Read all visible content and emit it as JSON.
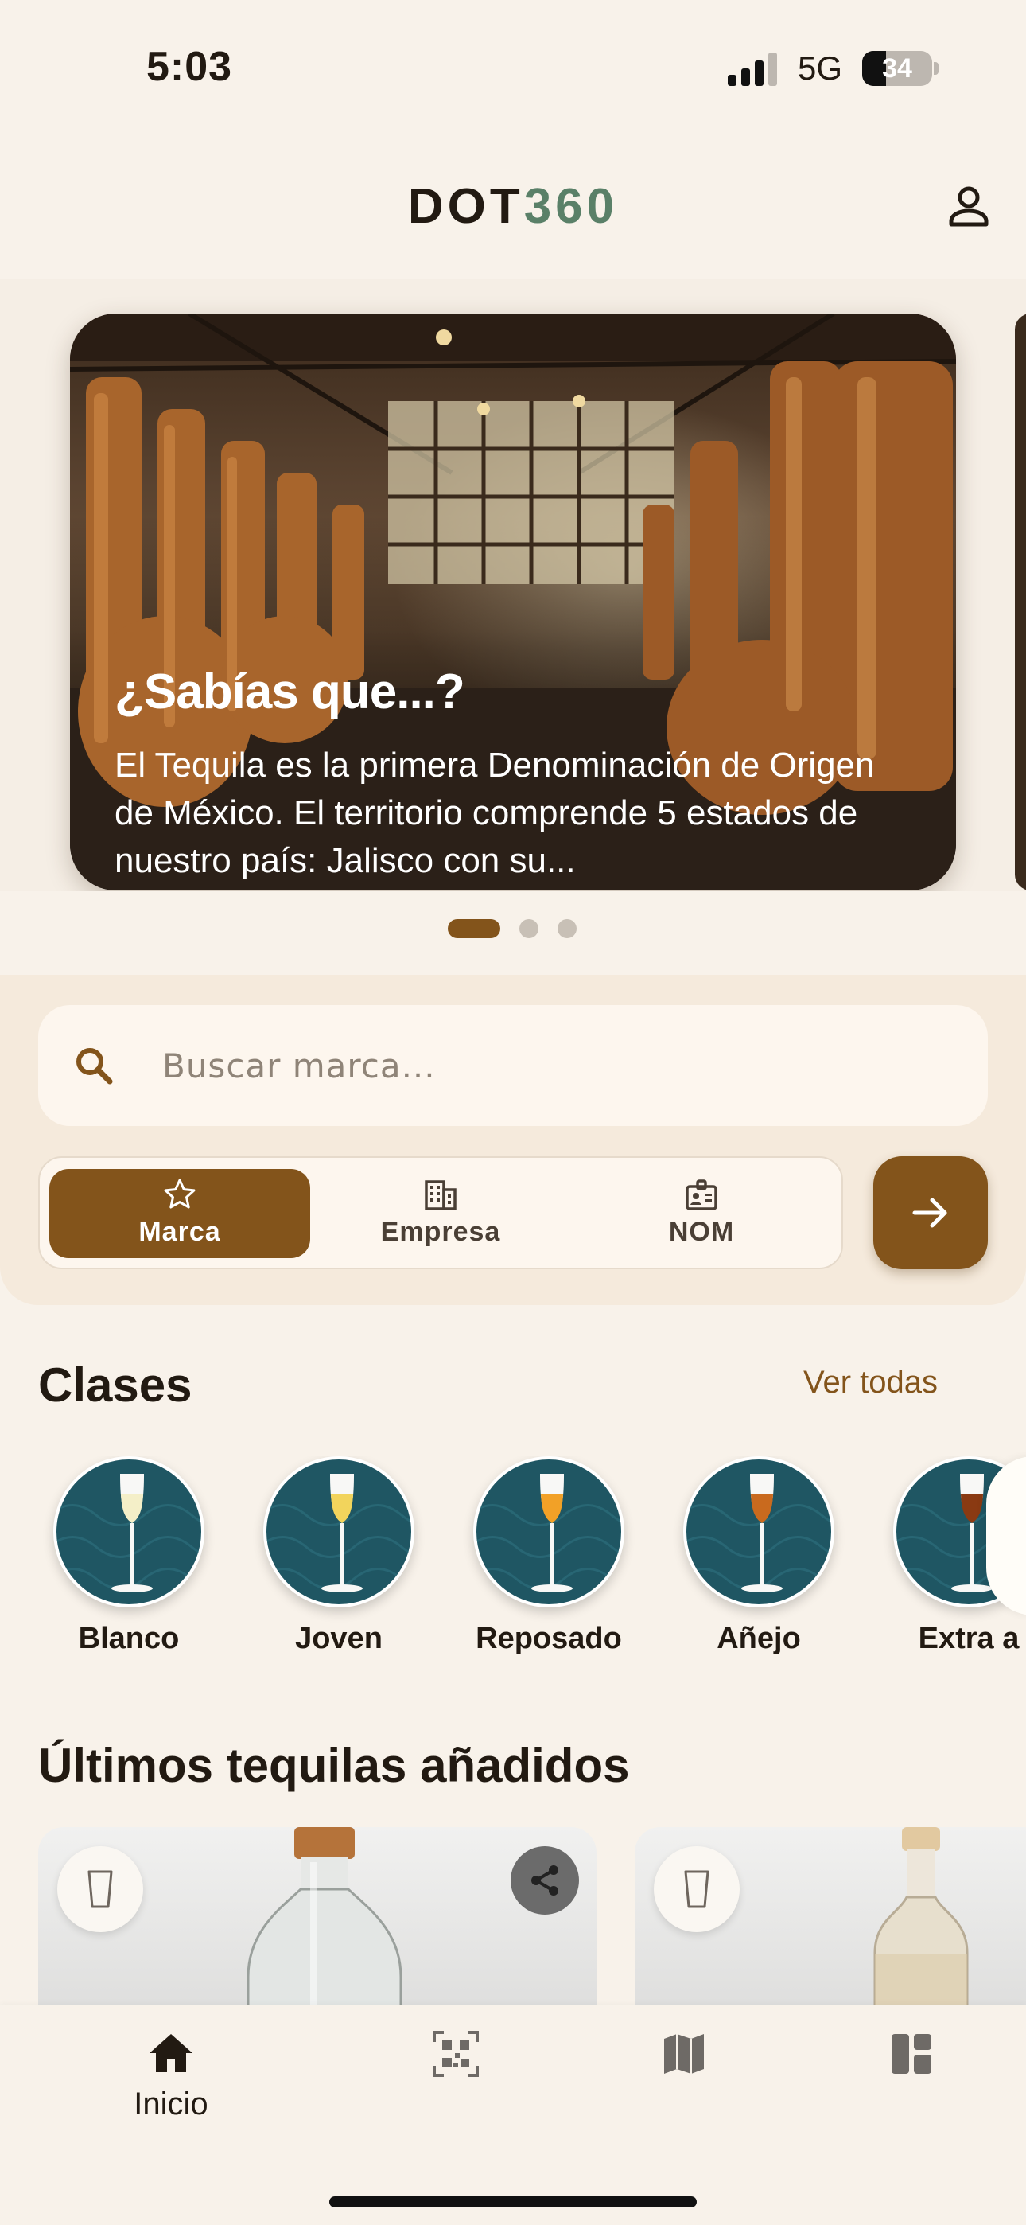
{
  "status_bar": {
    "time": "5:03",
    "network": "5G",
    "battery": "34",
    "battery_level": 0.34
  },
  "header": {
    "logo_part1": "DOT",
    "logo_part2": "360",
    "profile_icon": "person-outline-icon"
  },
  "carousel": {
    "slide_title": "¿Sabías que...?",
    "slide_text": "El Tequila es la primera Denominación de Origen de México. El territorio comprende 5 estados de nuestro país: Jalisco con su...",
    "slide_count": 3,
    "active_slide": 1
  },
  "search": {
    "placeholder": "Buscar marca...",
    "value": "",
    "icon": "search-icon"
  },
  "filters": {
    "items": [
      {
        "label": "Marca",
        "icon": "star-outline-icon",
        "active": true
      },
      {
        "label": "Empresa",
        "icon": "building-icon",
        "active": false
      },
      {
        "label": "NOM",
        "icon": "id-badge-icon",
        "active": false
      }
    ],
    "go_icon": "arrow-right-icon"
  },
  "classes": {
    "title": "Clases",
    "see_all": "Ver todas",
    "items": [
      {
        "label": "Blanco",
        "liquid_color": "#F4EFC8"
      },
      {
        "label": "Joven",
        "liquid_color": "#F2D45C"
      },
      {
        "label": "Reposado",
        "liquid_color": "#F2A127"
      },
      {
        "label": "Añejo",
        "liquid_color": "#C96A1E"
      },
      {
        "label": "Extra a",
        "liquid_color": "#8A3A12"
      }
    ]
  },
  "latest": {
    "title": "Últimos tequilas añadidos"
  },
  "bottom_nav": {
    "items": [
      {
        "label": "Inicio",
        "icon": "home-icon",
        "active": true
      },
      {
        "label": "",
        "icon": "qr-scan-icon",
        "active": false
      },
      {
        "label": "",
        "icon": "map-icon",
        "active": false
      },
      {
        "label": "",
        "icon": "dashboard-icon",
        "active": false
      }
    ]
  },
  "colors": {
    "accent": "#83541B",
    "logo_green": "#5A8068",
    "background": "#F8F2EA",
    "class_circle": "#1F5663"
  }
}
